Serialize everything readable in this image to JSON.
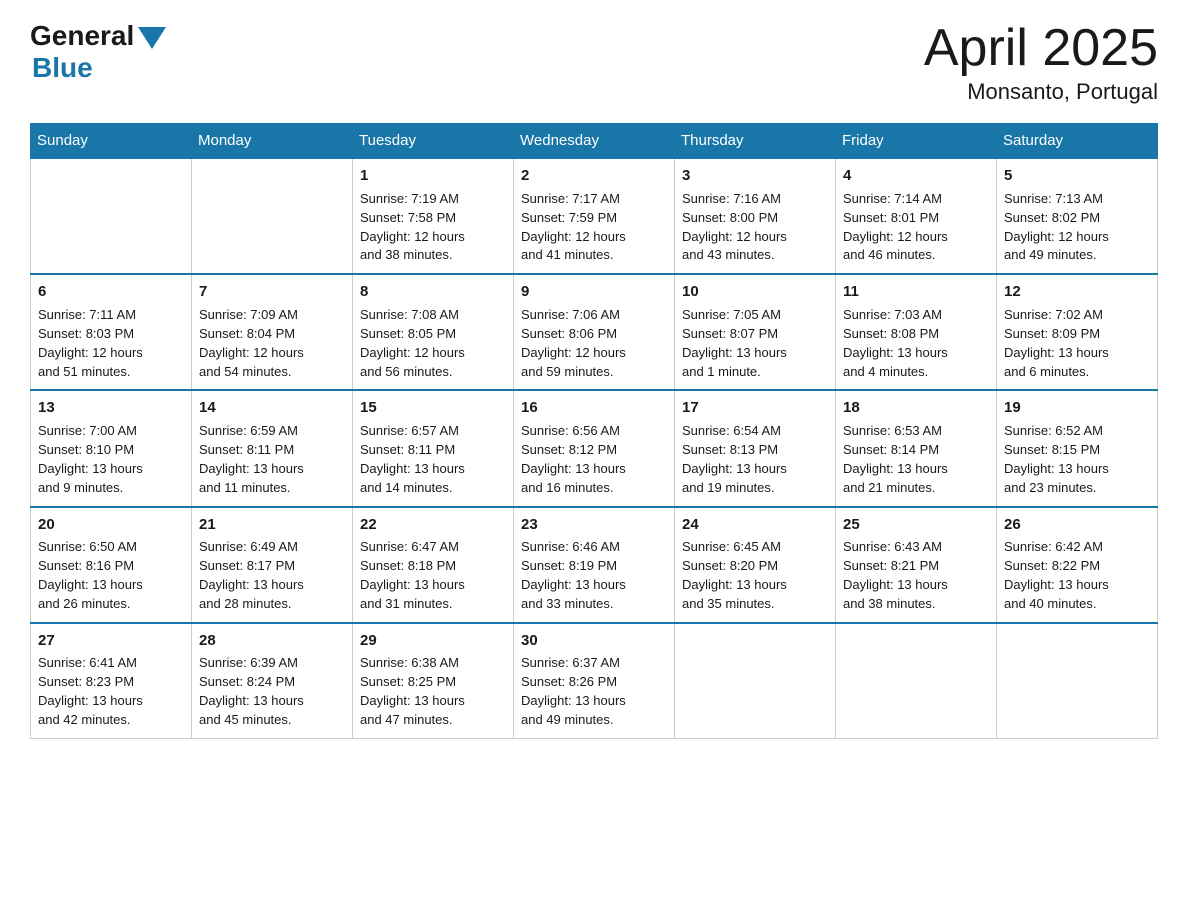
{
  "logo": {
    "general": "General",
    "blue": "Blue"
  },
  "title": {
    "month": "April 2025",
    "location": "Monsanto, Portugal"
  },
  "weekdays": [
    "Sunday",
    "Monday",
    "Tuesday",
    "Wednesday",
    "Thursday",
    "Friday",
    "Saturday"
  ],
  "weeks": [
    [
      {
        "day": "",
        "info": ""
      },
      {
        "day": "",
        "info": ""
      },
      {
        "day": "1",
        "info": "Sunrise: 7:19 AM\nSunset: 7:58 PM\nDaylight: 12 hours\nand 38 minutes."
      },
      {
        "day": "2",
        "info": "Sunrise: 7:17 AM\nSunset: 7:59 PM\nDaylight: 12 hours\nand 41 minutes."
      },
      {
        "day": "3",
        "info": "Sunrise: 7:16 AM\nSunset: 8:00 PM\nDaylight: 12 hours\nand 43 minutes."
      },
      {
        "day": "4",
        "info": "Sunrise: 7:14 AM\nSunset: 8:01 PM\nDaylight: 12 hours\nand 46 minutes."
      },
      {
        "day": "5",
        "info": "Sunrise: 7:13 AM\nSunset: 8:02 PM\nDaylight: 12 hours\nand 49 minutes."
      }
    ],
    [
      {
        "day": "6",
        "info": "Sunrise: 7:11 AM\nSunset: 8:03 PM\nDaylight: 12 hours\nand 51 minutes."
      },
      {
        "day": "7",
        "info": "Sunrise: 7:09 AM\nSunset: 8:04 PM\nDaylight: 12 hours\nand 54 minutes."
      },
      {
        "day": "8",
        "info": "Sunrise: 7:08 AM\nSunset: 8:05 PM\nDaylight: 12 hours\nand 56 minutes."
      },
      {
        "day": "9",
        "info": "Sunrise: 7:06 AM\nSunset: 8:06 PM\nDaylight: 12 hours\nand 59 minutes."
      },
      {
        "day": "10",
        "info": "Sunrise: 7:05 AM\nSunset: 8:07 PM\nDaylight: 13 hours\nand 1 minute."
      },
      {
        "day": "11",
        "info": "Sunrise: 7:03 AM\nSunset: 8:08 PM\nDaylight: 13 hours\nand 4 minutes."
      },
      {
        "day": "12",
        "info": "Sunrise: 7:02 AM\nSunset: 8:09 PM\nDaylight: 13 hours\nand 6 minutes."
      }
    ],
    [
      {
        "day": "13",
        "info": "Sunrise: 7:00 AM\nSunset: 8:10 PM\nDaylight: 13 hours\nand 9 minutes."
      },
      {
        "day": "14",
        "info": "Sunrise: 6:59 AM\nSunset: 8:11 PM\nDaylight: 13 hours\nand 11 minutes."
      },
      {
        "day": "15",
        "info": "Sunrise: 6:57 AM\nSunset: 8:11 PM\nDaylight: 13 hours\nand 14 minutes."
      },
      {
        "day": "16",
        "info": "Sunrise: 6:56 AM\nSunset: 8:12 PM\nDaylight: 13 hours\nand 16 minutes."
      },
      {
        "day": "17",
        "info": "Sunrise: 6:54 AM\nSunset: 8:13 PM\nDaylight: 13 hours\nand 19 minutes."
      },
      {
        "day": "18",
        "info": "Sunrise: 6:53 AM\nSunset: 8:14 PM\nDaylight: 13 hours\nand 21 minutes."
      },
      {
        "day": "19",
        "info": "Sunrise: 6:52 AM\nSunset: 8:15 PM\nDaylight: 13 hours\nand 23 minutes."
      }
    ],
    [
      {
        "day": "20",
        "info": "Sunrise: 6:50 AM\nSunset: 8:16 PM\nDaylight: 13 hours\nand 26 minutes."
      },
      {
        "day": "21",
        "info": "Sunrise: 6:49 AM\nSunset: 8:17 PM\nDaylight: 13 hours\nand 28 minutes."
      },
      {
        "day": "22",
        "info": "Sunrise: 6:47 AM\nSunset: 8:18 PM\nDaylight: 13 hours\nand 31 minutes."
      },
      {
        "day": "23",
        "info": "Sunrise: 6:46 AM\nSunset: 8:19 PM\nDaylight: 13 hours\nand 33 minutes."
      },
      {
        "day": "24",
        "info": "Sunrise: 6:45 AM\nSunset: 8:20 PM\nDaylight: 13 hours\nand 35 minutes."
      },
      {
        "day": "25",
        "info": "Sunrise: 6:43 AM\nSunset: 8:21 PM\nDaylight: 13 hours\nand 38 minutes."
      },
      {
        "day": "26",
        "info": "Sunrise: 6:42 AM\nSunset: 8:22 PM\nDaylight: 13 hours\nand 40 minutes."
      }
    ],
    [
      {
        "day": "27",
        "info": "Sunrise: 6:41 AM\nSunset: 8:23 PM\nDaylight: 13 hours\nand 42 minutes."
      },
      {
        "day": "28",
        "info": "Sunrise: 6:39 AM\nSunset: 8:24 PM\nDaylight: 13 hours\nand 45 minutes."
      },
      {
        "day": "29",
        "info": "Sunrise: 6:38 AM\nSunset: 8:25 PM\nDaylight: 13 hours\nand 47 minutes."
      },
      {
        "day": "30",
        "info": "Sunrise: 6:37 AM\nSunset: 8:26 PM\nDaylight: 13 hours\nand 49 minutes."
      },
      {
        "day": "",
        "info": ""
      },
      {
        "day": "",
        "info": ""
      },
      {
        "day": "",
        "info": ""
      }
    ]
  ]
}
